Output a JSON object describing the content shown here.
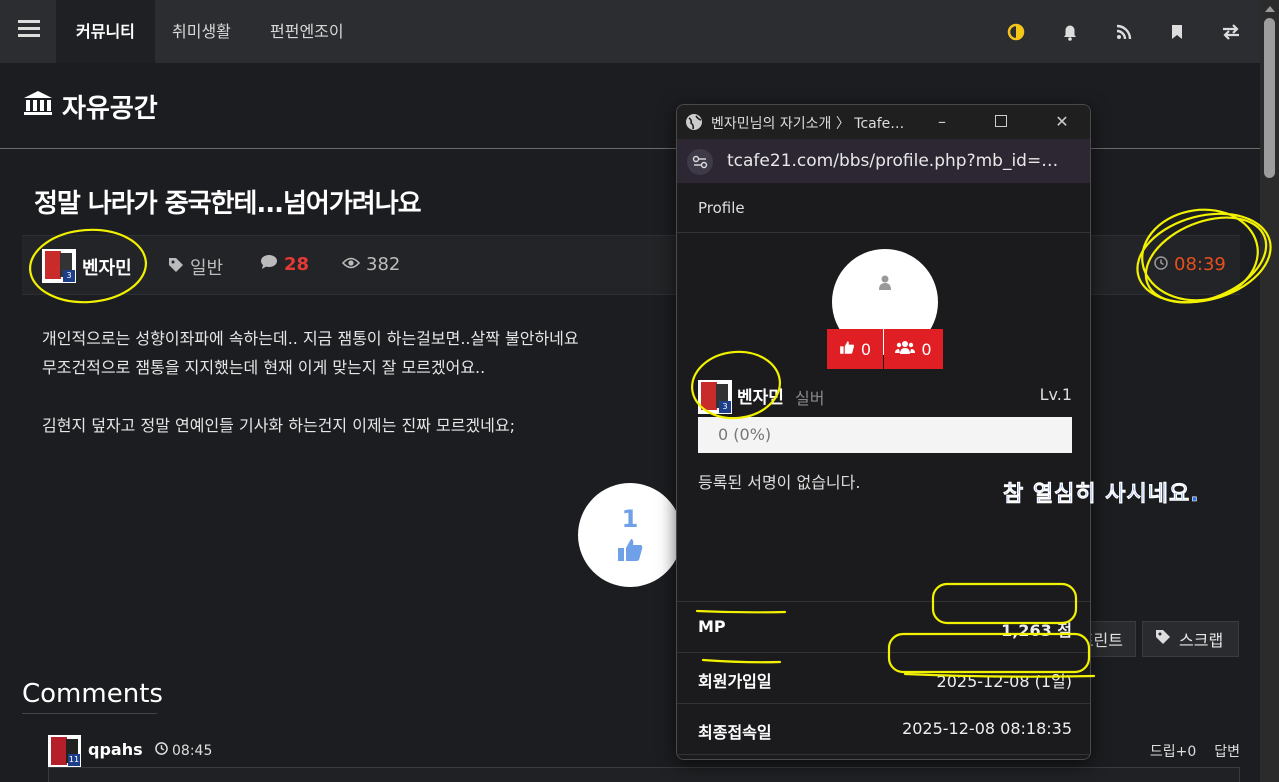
{
  "nav": {
    "tabs": [
      {
        "label": "커뮤니티",
        "active": true
      },
      {
        "label": "취미생활",
        "active": false
      },
      {
        "label": "펀펀엔조이",
        "active": false
      }
    ],
    "icons": [
      "menu-icon",
      "theme-toggle-icon",
      "bell-icon",
      "rss-icon",
      "bookmark-icon",
      "swap-icon"
    ],
    "theme_icon_color": "#f5c518"
  },
  "board": {
    "title": "자유공간",
    "icon": "bank-icon"
  },
  "post": {
    "title": "정말 나라가 중국한테...넘어가려나요",
    "author": "벤자민",
    "author_level_badge": "3",
    "category": "일반",
    "comment_count": "28",
    "views": "382",
    "time": "08:39",
    "body": [
      "개인적으로는 성향이좌파에 속하는데.. 지금 잼통이 하는걸보면..살짝 불안하네요",
      "무조건적으로 잼통을 지지했는데 현재 이게 맞는지 잘 모르겠어요..",
      "",
      "김현지 덮자고 정말 연예인들 기사화 하는건지 이제는 진짜 모르겠네요;"
    ],
    "likes": "1",
    "actions": {
      "print": "프린트",
      "scrap": "스크랩"
    }
  },
  "comments": {
    "title": "Comments",
    "first": {
      "author": "qpahs",
      "badge": "11",
      "time": "08:45",
      "draw": "드립+0",
      "reply": "답변"
    }
  },
  "popup": {
    "window_title": "벤자민님의 자기소개 〉 Tcafe…",
    "url": "tcafe21.com/bbs/profile.php?mb_id=…",
    "header": "Profile",
    "like_count": "0",
    "friend_count": "0",
    "name": "벤자민",
    "grade": "실버",
    "level": "Lv.1",
    "xp": "0 (0%)",
    "signature": "등록된 서명이 없습니다.",
    "rows": [
      {
        "label": "MP",
        "value": "1,263 점"
      },
      {
        "label": "회원가입일",
        "value": "2025-12-08 (1일)"
      },
      {
        "label": "최종접속일",
        "value": "2025-12-08 08:18:35"
      }
    ],
    "close_label": "닫기"
  },
  "annotation": {
    "text": "참 열심히 사시네요.",
    "marker_color": "#f2f200",
    "text_color": "#2d6ff5"
  },
  "colors": {
    "background": "#1c1d20",
    "accent_red": "#e01f24",
    "time_orange": "#e6501e"
  }
}
